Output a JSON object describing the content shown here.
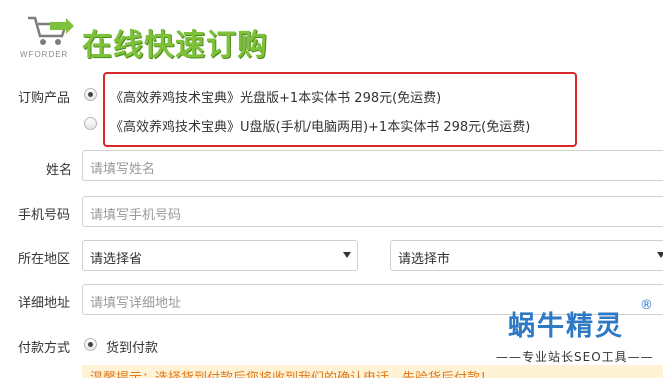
{
  "header": {
    "logo_text": "WFORDER",
    "title": "在线快速订购"
  },
  "order": {
    "product_label": "订购产品",
    "options": [
      {
        "text": "《高效养鸡技术宝典》光盘版+1本实体书 298元(免运费)",
        "selected": true
      },
      {
        "text": "《高效养鸡技术宝典》U盘版(手机/电脑两用)+1本实体书 298元(免运费)",
        "selected": false
      }
    ]
  },
  "fields": {
    "name": {
      "label": "姓名",
      "placeholder": "请填写姓名"
    },
    "phone": {
      "label": "手机号码",
      "placeholder": "请填写手机号码"
    },
    "region": {
      "label": "所在地区",
      "province": "请选择省",
      "city": "请选择市"
    },
    "address": {
      "label": "详细地址",
      "placeholder": "请填写详细地址"
    },
    "payment": {
      "label": "付款方式",
      "option": "货到付款"
    }
  },
  "notice": {
    "text": "温馨提示：选择货到付款后您将收到我们的确认电话，先验货后付款！"
  },
  "watermark": {
    "title": "蜗牛精灵",
    "registered": "®",
    "subtitle": "——专业站长SEO工具——"
  },
  "colors": {
    "title_green": "#7ec23c",
    "highlight_red": "#d9262b",
    "watermark_blue": "#2d79c4"
  }
}
